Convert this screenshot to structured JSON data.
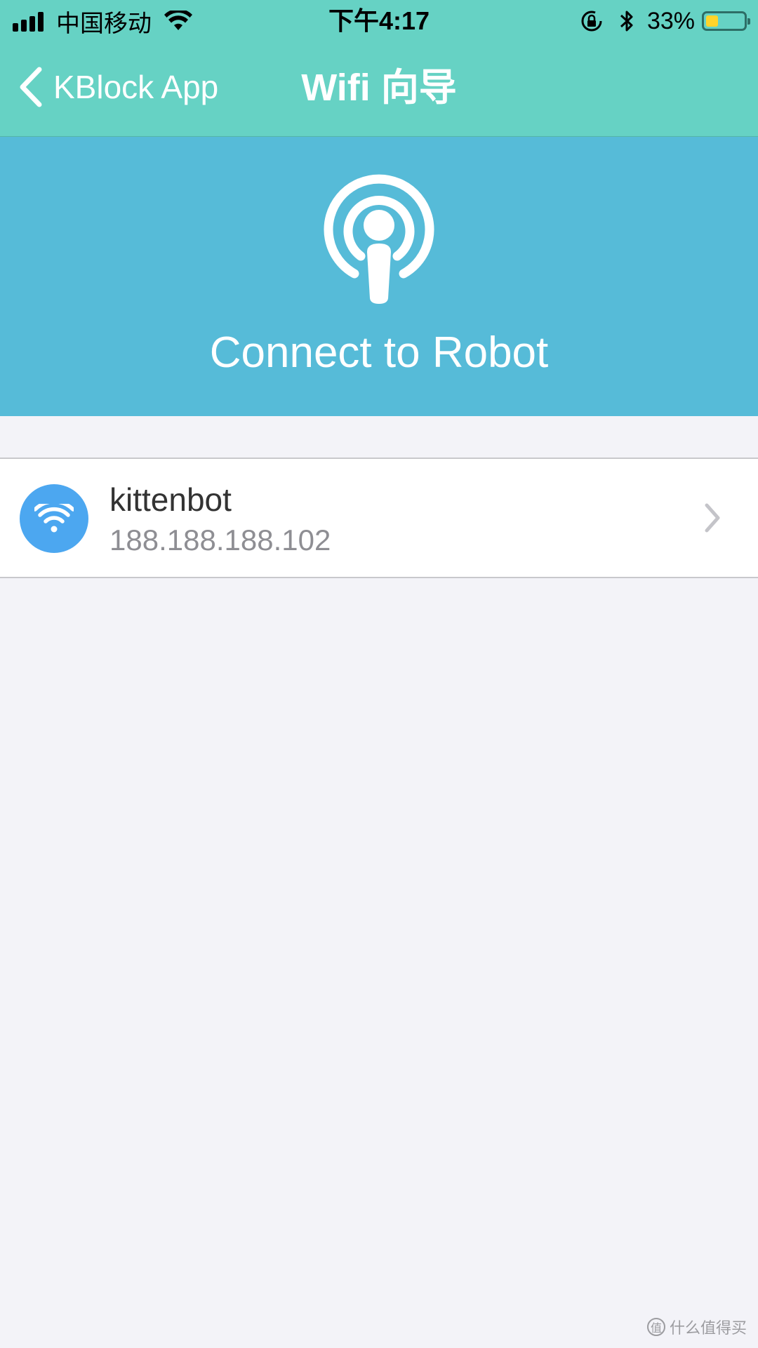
{
  "status_bar": {
    "carrier": "中国移动",
    "time": "下午4:17",
    "battery_percent": "33%",
    "battery_level": 0.33,
    "icons": [
      "signal-bars-icon",
      "wifi-icon",
      "rotation-lock-icon",
      "bluetooth-icon",
      "battery-icon"
    ]
  },
  "nav": {
    "back_label": "KBlock App",
    "title": "Wifi 向导"
  },
  "hero": {
    "icon": "broadcast-person-icon",
    "text": "Connect to Robot"
  },
  "list": {
    "items": [
      {
        "name": "kittenbot",
        "ip": "188.188.188.102",
        "icon": "wifi-icon"
      }
    ]
  },
  "watermark": {
    "text": "什么值得买"
  },
  "colors": {
    "nav_bg": "#66d2c4",
    "hero_bg": "#56bbd8",
    "wifi_badge": "#4ca7f0",
    "page_bg": "#f3f3f8"
  }
}
